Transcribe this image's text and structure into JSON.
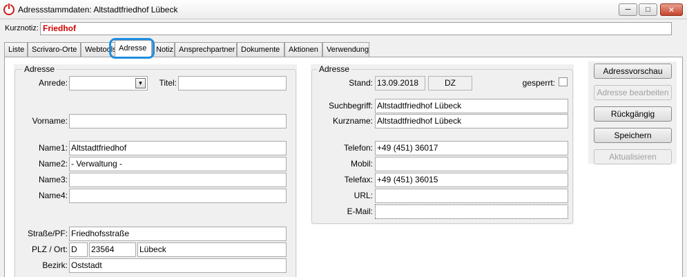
{
  "window": {
    "title": "Adressstammdaten: Altstadtfriedhof Lübeck",
    "minimize_glyph": "─",
    "maximize_glyph": "□",
    "close_glyph": "✕"
  },
  "kurznotiz": {
    "label": "Kurznotiz:",
    "value": "Friedhof"
  },
  "tabs": [
    {
      "label": "Liste"
    },
    {
      "label": "Scrivaro-Orte"
    },
    {
      "label": "Webtools"
    },
    {
      "label": "Adresse"
    },
    {
      "label": "Notiz"
    },
    {
      "label": "Ansprechpartner"
    },
    {
      "label": "Dokumente"
    },
    {
      "label": "Aktionen"
    },
    {
      "label": "Verwendung"
    }
  ],
  "left": {
    "group_title": "Adresse",
    "anrede_label": "Anrede:",
    "anrede_value": "",
    "titel_label": "Titel:",
    "titel_value": "",
    "vorname_label": "Vorname:",
    "vorname_value": "",
    "name1_label": "Name1:",
    "name1_value": "Altstadtfriedhof",
    "name2_label": "Name2:",
    "name2_value": "- Verwaltung -",
    "name3_label": "Name3:",
    "name3_value": "",
    "name4_label": "Name4:",
    "name4_value": "",
    "strasse_label": "Straße/PF:",
    "strasse_value": "Friedhofsstraße",
    "plz_label": "PLZ / Ort:",
    "land_value": "D",
    "plz_value": "23564",
    "ort_value": "Lübeck",
    "bezirk_label": "Bezirk:",
    "bezirk_value": "Oststadt"
  },
  "right": {
    "group_title": "Adresse",
    "stand_label": "Stand:",
    "stand_date": "13.09.2018",
    "stand_user": "DZ",
    "gesperrt_label": "gesperrt:",
    "gesperrt_checked": false,
    "suchbegriff_label": "Suchbegriff:",
    "suchbegriff_value": "Altstadtfriedhof Lübeck",
    "kurzname_label": "Kurzname:",
    "kurzname_value": "Altstadtfriedhof Lübeck",
    "telefon_label": "Telefon:",
    "telefon_value": "+49 (451) 36017",
    "mobil_label": "Mobil:",
    "mobil_value": "",
    "telefax_label": "Telefax:",
    "telefax_value": "+49 (451) 36015",
    "url_label": "URL:",
    "url_value": "",
    "email_label": "E-Mail:",
    "email_value": ""
  },
  "buttons": {
    "adressvorschau": "Adressvorschau",
    "adresse_bearbeiten": "Adresse bearbeiten",
    "rueckgaengig": "Rückgängig",
    "speichern": "Speichern",
    "aktualisieren": "Aktualisieren"
  },
  "icons": {
    "app": "power-icon",
    "combo": "chevron-down-icon"
  },
  "colors": {
    "kurznotiz_text": "#d00000",
    "tab_highlight": "#1e8ee0",
    "close_button": "#c7442c"
  }
}
